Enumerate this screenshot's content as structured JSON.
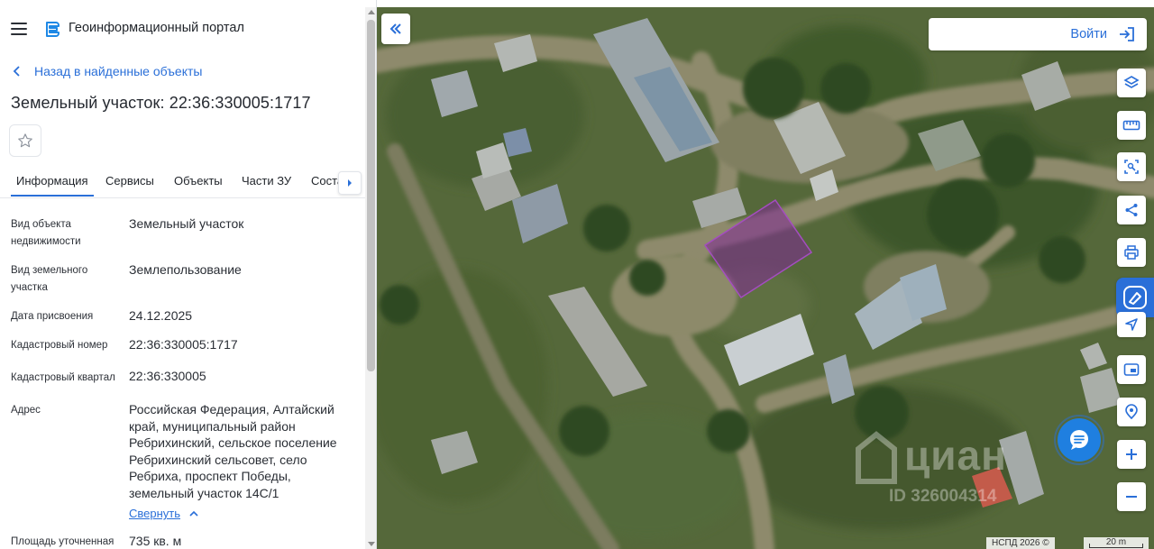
{
  "app": {
    "title": "Геоинформационный портал"
  },
  "nav": {
    "back_label": "Назад в найденные объекты"
  },
  "object": {
    "title": "Земельный участок: 22:36:330005:1717"
  },
  "tabs": [
    {
      "label": "Информация",
      "active": true
    },
    {
      "label": "Сервисы",
      "active": false
    },
    {
      "label": "Объекты",
      "active": false
    },
    {
      "label": "Части ЗУ",
      "active": false
    },
    {
      "label": "Состав",
      "active": false
    }
  ],
  "fields": [
    {
      "label": "Вид объекта недвижимости",
      "value": "Земельный участок"
    },
    {
      "label": "Вид земельного участка",
      "value": "Землепользование"
    },
    {
      "label": "Дата присвоения",
      "value": "24.12.2025"
    },
    {
      "label": "Кадастровый номер",
      "value": "22:36:330005:1717"
    },
    {
      "label": "Кадастровый квартал",
      "value": "22:36:330005"
    },
    {
      "label": "Адрес",
      "value": "Российская Федерация, Алтайский край, муниципальный район Ребрихинский, сельское поселение Ребрихинский сельсовет, село Ребриха, проспект Победы, земельный участок 14С/1"
    },
    {
      "label": "Площадь уточненная",
      "value": "735 кв. м"
    }
  ],
  "collapse_label": "Свернуть",
  "map": {
    "login_label": "Войти",
    "attribution": "НСПД 2026 ©",
    "scale_label": "20 m",
    "watermark_name": "циан",
    "watermark_id": "ID 326004314",
    "parcel_color": "#8a2a9a"
  },
  "tools": [
    "layers-icon",
    "ruler-icon",
    "select-area-icon",
    "share-icon",
    "print-icon",
    "draw-icon",
    "geolocation-icon",
    "screen-icon",
    "location-pin-icon",
    "zoom-in-icon",
    "zoom-out-icon"
  ],
  "colors": {
    "accent": "#2a6fd8",
    "chat": "#1f7fe0"
  }
}
